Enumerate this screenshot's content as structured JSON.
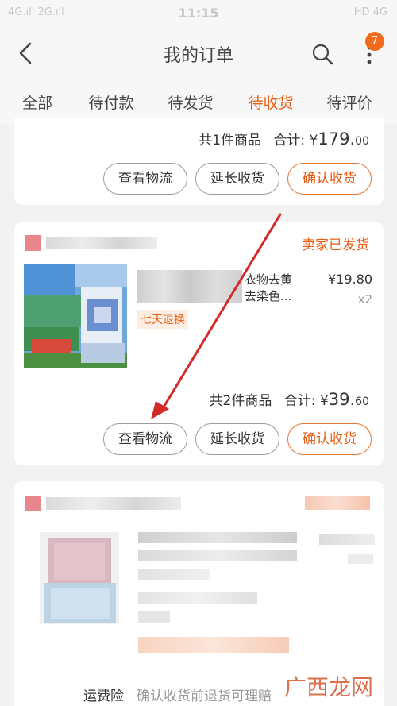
{
  "status_bar": {
    "left": "4G.ıll 2G.ıll",
    "time": "11:15",
    "right": "HD 4G"
  },
  "nav": {
    "title": "我的订单",
    "badge": "7"
  },
  "tabs": [
    {
      "label": "全部"
    },
    {
      "label": "待付款"
    },
    {
      "label": "待发货"
    },
    {
      "label": "待收货"
    },
    {
      "label": "待评价"
    }
  ],
  "orders": [
    {
      "summary_prefix": "共1件商品",
      "total_label": "合计:",
      "currency": "¥",
      "total_int": "179.",
      "total_dec": "00",
      "buttons": [
        "查看物流",
        "延长收货",
        "确认收货"
      ]
    },
    {
      "status": "卖家已发货",
      "product_title": "衣物去黄\n去染色...",
      "price": "¥19.80",
      "qty": "x2",
      "tag": "七天退换",
      "summary_prefix": "共2件商品",
      "total_label": "合计:",
      "currency": "¥",
      "total_int": "39.",
      "total_dec": "60",
      "buttons": [
        "查看物流",
        "延长收货",
        "确认收货"
      ]
    }
  ],
  "bottom": {
    "label": "运费险",
    "desc": "确认收货前退货可理赔",
    "watermark": "广西龙网"
  },
  "colors": {
    "accent": "#e85d13",
    "badge": "#f46a1d",
    "arrow": "#d42a2a"
  }
}
